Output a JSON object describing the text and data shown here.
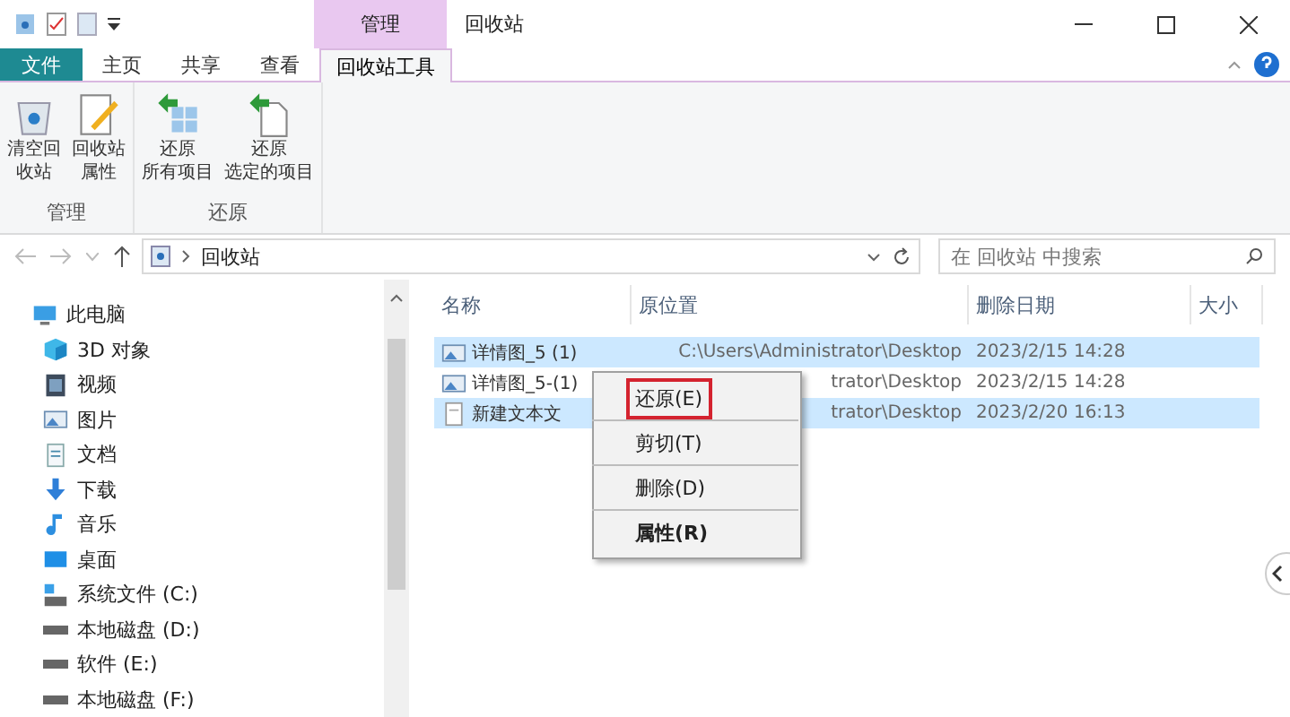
{
  "window": {
    "title": "回收站",
    "context_tab": "管理"
  },
  "tabs": [
    {
      "label": "文件",
      "kind": "file",
      "selected": false
    },
    {
      "label": "主页",
      "kind": "tab",
      "selected": false
    },
    {
      "label": "共享",
      "kind": "tab",
      "selected": false
    },
    {
      "label": "查看",
      "kind": "tab",
      "selected": false
    },
    {
      "label": "回收站工具",
      "kind": "tab",
      "selected": true
    }
  ],
  "ribbon_groups": [
    {
      "label": "管理",
      "buttons": [
        {
          "lines": [
            "清空回",
            "收站"
          ]
        },
        {
          "lines": [
            "回收站",
            "属性"
          ]
        }
      ]
    },
    {
      "label": "还原",
      "buttons": [
        {
          "lines": [
            "还原",
            "所有项目"
          ]
        },
        {
          "lines": [
            "还原",
            "选定的项目"
          ]
        }
      ]
    }
  ],
  "address": {
    "path": "回收站",
    "search_placeholder": "在 回收站 中搜索"
  },
  "nav": [
    {
      "label": "此电脑",
      "kind": "pc",
      "children": [
        {
          "label": "3D 对象",
          "kind": "cube"
        },
        {
          "label": "视频",
          "kind": "video"
        },
        {
          "label": "图片",
          "kind": "image"
        },
        {
          "label": "文档",
          "kind": "doc"
        },
        {
          "label": "下载",
          "kind": "download"
        },
        {
          "label": "音乐",
          "kind": "music"
        },
        {
          "label": "桌面",
          "kind": "desktop"
        },
        {
          "label": "系统文件 (C:)",
          "kind": "sysdrive"
        },
        {
          "label": "本地磁盘 (D:)",
          "kind": "drive"
        },
        {
          "label": "软件 (E:)",
          "kind": "drive"
        },
        {
          "label": "本地磁盘 (F:)",
          "kind": "drive"
        }
      ]
    }
  ],
  "table": {
    "columns": [
      "名称",
      "原位置",
      "删除日期",
      "大小"
    ],
    "rows": [
      {
        "name": "详情图_5 (1)",
        "kind": "image",
        "location": "C:\\Users\\Administrator\\Desktop",
        "date": "2023/2/15 14:28",
        "selected": true
      },
      {
        "name": "详情图_5-(1)",
        "kind": "image",
        "location": "trator\\Desktop",
        "date": "2023/2/15 14:28",
        "selected": false
      },
      {
        "name": "新建文本文",
        "kind": "text",
        "location": "trator\\Desktop",
        "date": "2023/2/20 16:13",
        "selected": true
      }
    ]
  },
  "context_menu": [
    {
      "label": "还原(E)",
      "highlighted": true,
      "bold": false
    },
    {
      "label": "剪切(T)",
      "highlighted": false,
      "bold": false
    },
    {
      "label": "删除(D)",
      "highlighted": false,
      "bold": false
    },
    {
      "label": "属性(R)",
      "highlighted": false,
      "bold": true
    }
  ]
}
